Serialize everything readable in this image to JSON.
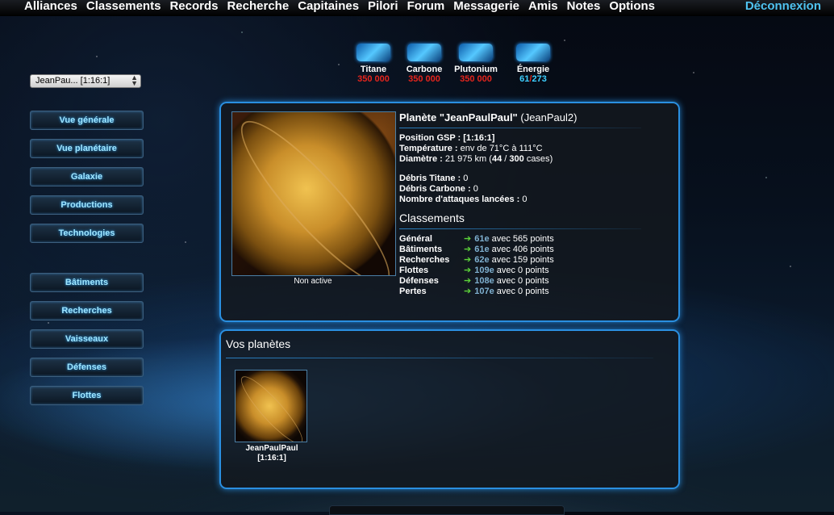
{
  "nav": {
    "items": [
      "Alliances",
      "Classements",
      "Records",
      "Recherche",
      "Capitaines",
      "Pilori",
      "Forum",
      "Messagerie",
      "Amis",
      "Notes",
      "Options"
    ],
    "logout": "Déconnexion"
  },
  "planet_selector": {
    "value": "JeanPau... [1:16:1]"
  },
  "resources": [
    {
      "name": "Titane",
      "value": "350 000",
      "icon": "titane-icon"
    },
    {
      "name": "Carbone",
      "value": "350 000",
      "icon": "carbone-icon"
    },
    {
      "name": "Plutonium",
      "value": "350 000",
      "icon": "plutonium-icon"
    },
    {
      "name": "Énergie",
      "available": "61",
      "total": "273",
      "icon": "energie-icon"
    }
  ],
  "menu": {
    "group1": [
      "Vue générale",
      "Vue planétaire",
      "Galaxie",
      "Productions",
      "Technologies"
    ],
    "group2": [
      "Bâtiments",
      "Recherches",
      "Vaisseaux",
      "Défenses",
      "Flottes"
    ]
  },
  "planet": {
    "title": "Planète \"JeanPaulPaul\"",
    "owner": "(JeanPaul2)",
    "status": "Non active",
    "position_label": "Position GSP :",
    "position_value": "[1:16:1]",
    "temperature_label": "Température :",
    "temperature_value": "env de 71°C à 111°C",
    "diameter_label": "Diamètre :",
    "diameter_value": "21 975 km",
    "cases_used": "44",
    "cases_total": "300",
    "cases_word": "cases",
    "debris_titane_label": "Débris Titane :",
    "debris_titane_value": "0",
    "debris_carbone_label": "Débris Carbone :",
    "debris_carbone_value": "0",
    "attacks_label": "Nombre d'attaques lancées :",
    "attacks_value": "0"
  },
  "rankings": {
    "title": "Classements",
    "rows": [
      {
        "label": "Général",
        "rank": "61e",
        "text": "avec 565 points"
      },
      {
        "label": "Bâtiments",
        "rank": "61e",
        "text": "avec 406 points"
      },
      {
        "label": "Recherches",
        "rank": "62e",
        "text": "avec 159 points"
      },
      {
        "label": "Flottes",
        "rank": "109e",
        "text": "avec 0 points"
      },
      {
        "label": "Défenses",
        "rank": "108e",
        "text": "avec 0 points"
      },
      {
        "label": "Pertes",
        "rank": "107e",
        "text": "avec 0 points"
      }
    ]
  },
  "my_planets": {
    "title": "Vos planètes",
    "items": [
      {
        "name": "JeanPaulPaul",
        "coords": "[1:16:1]"
      }
    ]
  }
}
